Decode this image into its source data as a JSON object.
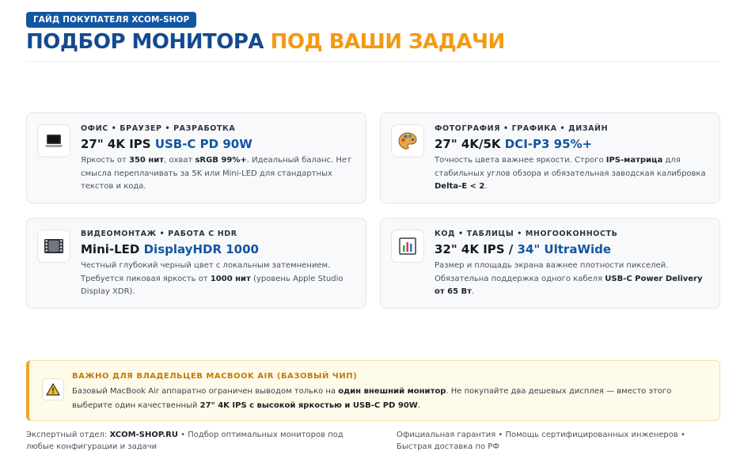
{
  "badge": "ГАЙД ПОКУПАТЕЛЯ XCOM-SHOP",
  "title": {
    "dark": "ПОДБОР МОНИТОРА",
    "accent": "ПОД ВАШИ ЗАДАЧИ"
  },
  "cards": [
    {
      "icon": "laptop-icon",
      "kicker": "ОФИС • БРАУЗЕР • РАЗРАБОТКА",
      "title_plain": "27\" 4K IPS",
      "title_hl": "USB-C PD 90W",
      "desc": [
        {
          "t": "Яркость от ",
          "b": false
        },
        {
          "t": "350 нит",
          "b": true
        },
        {
          "t": ", охват ",
          "b": false
        },
        {
          "t": "sRGB 99%+",
          "b": true
        },
        {
          "t": ". Идеальный баланс. Нет смысла переплачивать за 5K или Mini-LED для стандартных текстов и кода.",
          "b": false
        }
      ]
    },
    {
      "icon": "palette-icon",
      "kicker": "ФОТОГРАФИЯ • ГРАФИКА • ДИЗАЙН",
      "title_plain": "27\" 4K/5K",
      "title_hl": "DCI-P3 95%+",
      "desc": [
        {
          "t": "Точность цвета важнее яркости. Строго ",
          "b": false
        },
        {
          "t": "IPS-матрица",
          "b": true
        },
        {
          "t": " для стабильных углов обзора и обязательная заводская калибровка ",
          "b": false
        },
        {
          "t": "Delta-E < 2",
          "b": true
        },
        {
          "t": ".",
          "b": false
        }
      ]
    },
    {
      "icon": "film-icon",
      "kicker": "ВИДЕОМОНТАЖ • РАБОТА С HDR",
      "title_plain": "Mini-LED",
      "title_hl": "DisplayHDR 1000",
      "desc": [
        {
          "t": "Честный глубокий черный цвет с локальным затемнением. Требуется пиковая яркость от ",
          "b": false
        },
        {
          "t": "1000 нит",
          "b": true
        },
        {
          "t": " (уровень Apple Studio Display XDR).",
          "b": false
        }
      ]
    },
    {
      "icon": "bar-chart-icon",
      "kicker": "КОД • ТАБЛИЦЫ • МНОГООКОННОСТЬ",
      "title_plain": "32\" 4K IPS /",
      "title_hl": "34\" UltraWide",
      "desc": [
        {
          "t": "Размер и площадь экрана важнее плотности пикселей. Обязательна поддержка одного кабеля ",
          "b": false
        },
        {
          "t": "USB-C Power Delivery от 65 Вт",
          "b": true
        },
        {
          "t": ".",
          "b": false
        }
      ]
    }
  ],
  "warning": {
    "icon": "warning-icon",
    "title": "ВАЖНО ДЛЯ ВЛАДЕЛЬЦЕВ MACBOOK AIR (БАЗОВЫЙ ЧИП)",
    "text": [
      {
        "t": "Базовый MacBook Air аппаратно ограничен выводом только на ",
        "b": false
      },
      {
        "t": "один внешний монитор",
        "b": true
      },
      {
        "t": ". Не покупайте два дешевых дисплея — вместо этого выберите один качественный ",
        "b": false
      },
      {
        "t": "27\" 4K IPS с высокой яркостью и USB-C PD 90W",
        "b": true
      },
      {
        "t": ".",
        "b": false
      }
    ]
  },
  "footer": {
    "left_prefix": "Экспертный отдел: ",
    "left_brand": "XCOM-SHOP.RU",
    "left_suffix": " • Подбор оптимальных мониторов под любые конфигурации и задачи",
    "right": "Официальная гарантия • Помощь сертифицированных инженеров • Быстрая доставка по РФ"
  },
  "colors": {
    "brand": "#1356a3",
    "accent": "#f39a12",
    "warning": "#c47a08"
  }
}
